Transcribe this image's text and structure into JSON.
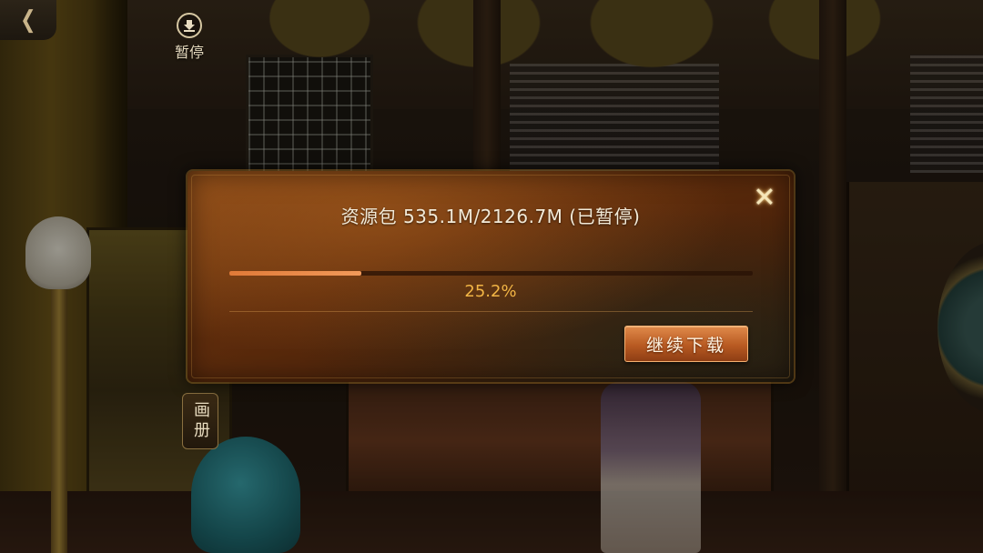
{
  "hud": {
    "back_icon": "back-arrow-icon",
    "back_glyph": "❮",
    "pause_icon": "download-icon",
    "pause_label": "暂停",
    "album_label": "画册"
  },
  "dialog": {
    "title": "资源包 535.1M/2126.7M (已暂停)",
    "progress": {
      "percent_value": 25.2,
      "percent_text": "25.2%"
    },
    "close_icon": "close-x-icon",
    "resume_button_label": "继续下载"
  },
  "colors": {
    "accent_orange": "#e07a38",
    "progress_text": "#f2b545",
    "button_gradient_top": "#e08a4a"
  }
}
